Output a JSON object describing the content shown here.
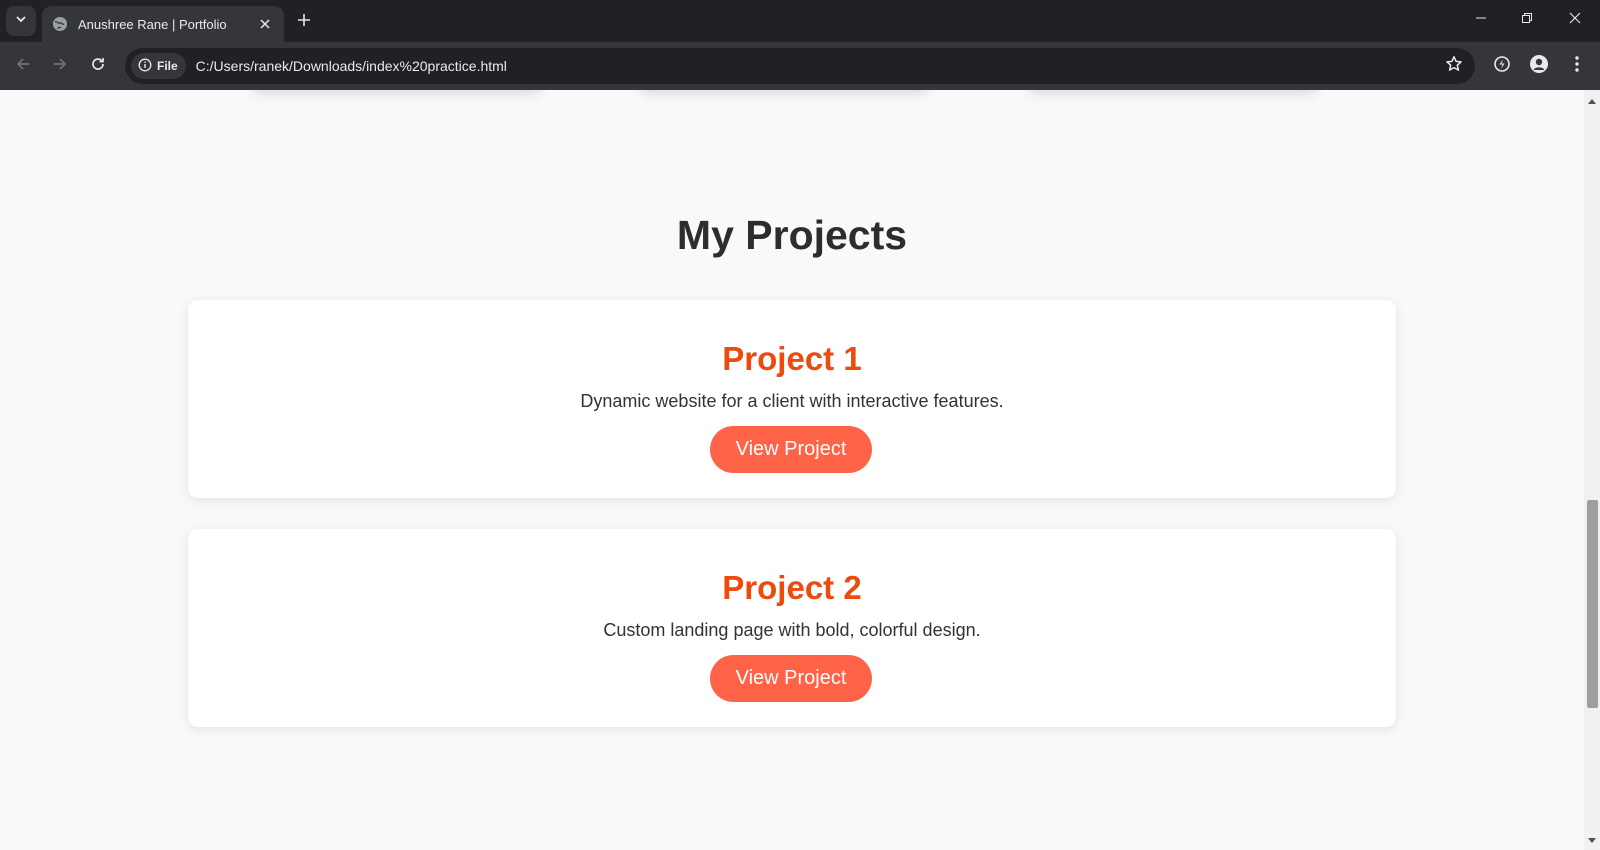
{
  "browser": {
    "tab": {
      "title": "Anushree Rane | Portfolio",
      "favicon": "globe-icon"
    },
    "address": {
      "chip_label": "File",
      "url": "C:/Users/ranek/Downloads/index%20practice.html"
    },
    "colors": {
      "frame": "#202124",
      "toolbar": "#35363a",
      "text": "#e8eaed"
    }
  },
  "page": {
    "section_title": "My Projects",
    "projects": [
      {
        "title": "Project 1",
        "description": "Dynamic website for a client with interactive features.",
        "button_label": "View Project"
      },
      {
        "title": "Project 2",
        "description": "Custom landing page with bold, colorful design.",
        "button_label": "View Project"
      }
    ],
    "colors": {
      "accent_title": "#ee4a0e",
      "button_bg": "#ff6347",
      "heading": "#2d2d2d",
      "background": "#f9f9f9"
    }
  },
  "scroll": {
    "position_fraction": 0.82
  }
}
